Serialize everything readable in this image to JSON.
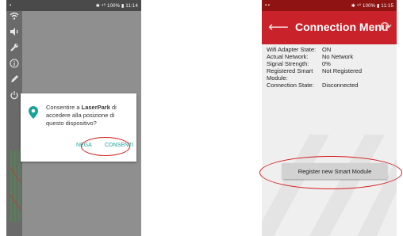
{
  "left_phone": {
    "status": {
      "icons": "▪",
      "right": "✱ ⁴⁰ 100% ▮ 11:14"
    },
    "sidebar_icons": [
      "wifi-icon",
      "volume-icon",
      "wrench-icon",
      "info-icon",
      "pencil-icon",
      "power-icon"
    ],
    "dialog": {
      "message_pre": "Consentire a ",
      "app_name": "LaserPark",
      "message_post": " di accedere alla posizione di questo dispositivo?",
      "deny_label": "NEGA",
      "allow_label": "CONSENTI"
    }
  },
  "right_phone": {
    "status": {
      "icons": "▪ ▪",
      "right": "✱ ⁴⁰ 100% ▮ 11:15"
    },
    "title": "Connection Menu",
    "rows": [
      {
        "label": "Wifi Adapter State:",
        "value": "ON"
      },
      {
        "label": "Actual Network:",
        "value": "No Network"
      },
      {
        "label": "Signal Strength:",
        "value": "0%"
      },
      {
        "label": "Registered Smart Module:",
        "value": "Not Registered"
      },
      {
        "label": "Connection State:",
        "value": "Disconnected"
      }
    ],
    "register_label": "Register new Smart Module"
  },
  "colors": {
    "accent_red": "#c9222a",
    "teal": "#1aa39a",
    "annotation_red": "#d61a1a"
  }
}
